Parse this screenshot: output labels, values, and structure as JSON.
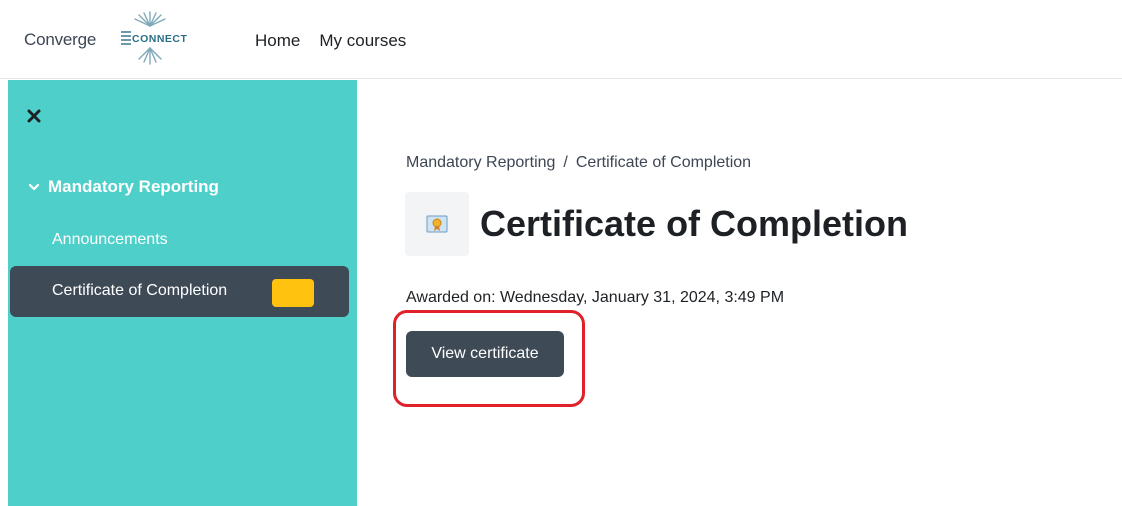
{
  "brand": {
    "name": "Converge",
    "sub": "CONNECT"
  },
  "nav": {
    "items": [
      "Home",
      "My courses"
    ]
  },
  "sidebar": {
    "section": "Mandatory Reporting",
    "items": [
      {
        "label": "Announcements",
        "active": false
      },
      {
        "label": "Certificate of Completion",
        "active": true
      }
    ]
  },
  "breadcrumb": {
    "parent": "Mandatory Reporting",
    "separator": "/",
    "current": "Certificate of Completion"
  },
  "main": {
    "title": "Certificate of Completion",
    "awarded_text": "Awarded on: Wednesday, January 31, 2024, 3:49 PM",
    "button_label": "View certificate"
  },
  "colors": {
    "sidebar_bg": "#4ecfca",
    "active_item_bg": "#3f4a57",
    "button_bg": "#3f4a57",
    "badge": "#ffc20e",
    "highlight": "#e0212a"
  },
  "icons": [
    "close-icon",
    "chevron-down-icon",
    "certificate-icon"
  ]
}
